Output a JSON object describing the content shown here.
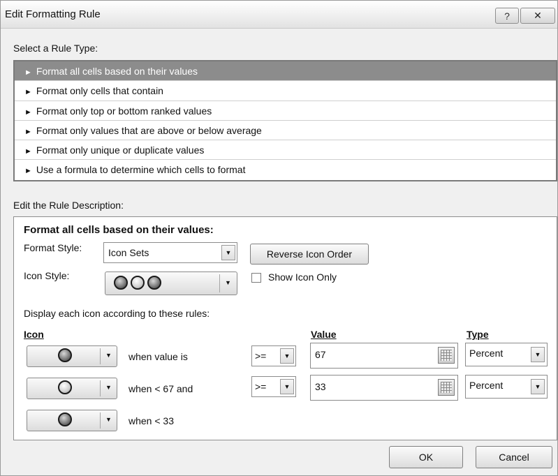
{
  "window": {
    "title": "Edit Formatting Rule",
    "help_glyph": "?",
    "close_glyph": "✕"
  },
  "rule_type": {
    "label": "Select a Rule Type:",
    "items": [
      {
        "label": "Format all cells based on their values",
        "selected": true
      },
      {
        "label": "Format only cells that contain",
        "selected": false
      },
      {
        "label": "Format only top or bottom ranked values",
        "selected": false
      },
      {
        "label": "Format only values that are above or below average",
        "selected": false
      },
      {
        "label": "Format only unique or duplicate values",
        "selected": false
      },
      {
        "label": "Use a formula to determine which cells to format",
        "selected": false
      }
    ],
    "arrow_glyph": "►"
  },
  "description": {
    "label": "Edit the Rule Description:",
    "heading": "Format all cells based on their values:",
    "format_style_label": "Format Style:",
    "format_style_value": "Icon Sets",
    "reverse_button": "Reverse Icon Order",
    "icon_style_label": "Icon Style:",
    "show_icon_only_label": "Show Icon Only",
    "show_icon_only_checked": false,
    "rules_intro": "Display each icon according to these rules:",
    "col_icon": "Icon",
    "col_value": "Value",
    "col_type": "Type",
    "rules": [
      {
        "icon": "dark-circle-icon",
        "condition": "when value is",
        "operator": ">=",
        "value": "67",
        "type": "Percent"
      },
      {
        "icon": "light-circle-icon",
        "condition": "when < 67 and",
        "operator": ">=",
        "value": "33",
        "type": "Percent"
      },
      {
        "icon": "dark-circle-icon",
        "condition": "when < 33"
      }
    ]
  },
  "footer": {
    "ok": "OK",
    "cancel": "Cancel"
  },
  "glyphs": {
    "dropdown": "▼"
  }
}
